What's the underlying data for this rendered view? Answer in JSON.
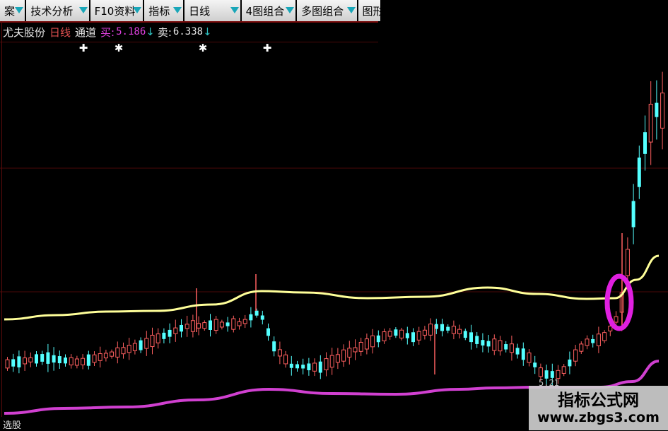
{
  "toolbar": {
    "items": [
      {
        "label": "案",
        "width": 38
      },
      {
        "label": "技术分析",
        "width": 92
      },
      {
        "label": "F10资料",
        "width": 78
      },
      {
        "label": "指标",
        "width": 58
      },
      {
        "label": "日线",
        "width": 82
      },
      {
        "label": "4图组合",
        "width": 80
      },
      {
        "label": "多图组合",
        "width": 88
      },
      {
        "label": "图形",
        "width": 34
      }
    ]
  },
  "info": {
    "stock": "尤夫股份",
    "period": "日线",
    "indicator": "通道",
    "buy_label": "买:",
    "buy_value": "5.186",
    "buy_arrow": "↓",
    "sell_label": "卖:",
    "sell_value": "6.338",
    "sell_arrow": "↓",
    "colors": {
      "stock": "#e8e8e8",
      "period": "#e05050",
      "indicator": "#e8e8e8",
      "buy": "#e040e0",
      "sell": "#e8e8e8",
      "arrow": "#30c0c0"
    }
  },
  "chart_data": {
    "type": "candlestick",
    "up_color": "#ff6060",
    "down_color": "#54ffff",
    "upper_band_color": "#ffff99",
    "lower_band_color": "#d040d0",
    "highlight_color": "#e020e0",
    "low_label": "5.21"
  },
  "bottom": {
    "label": "选股"
  },
  "watermark": {
    "title": "指标公式网",
    "url": "www.zbgs3.com"
  }
}
